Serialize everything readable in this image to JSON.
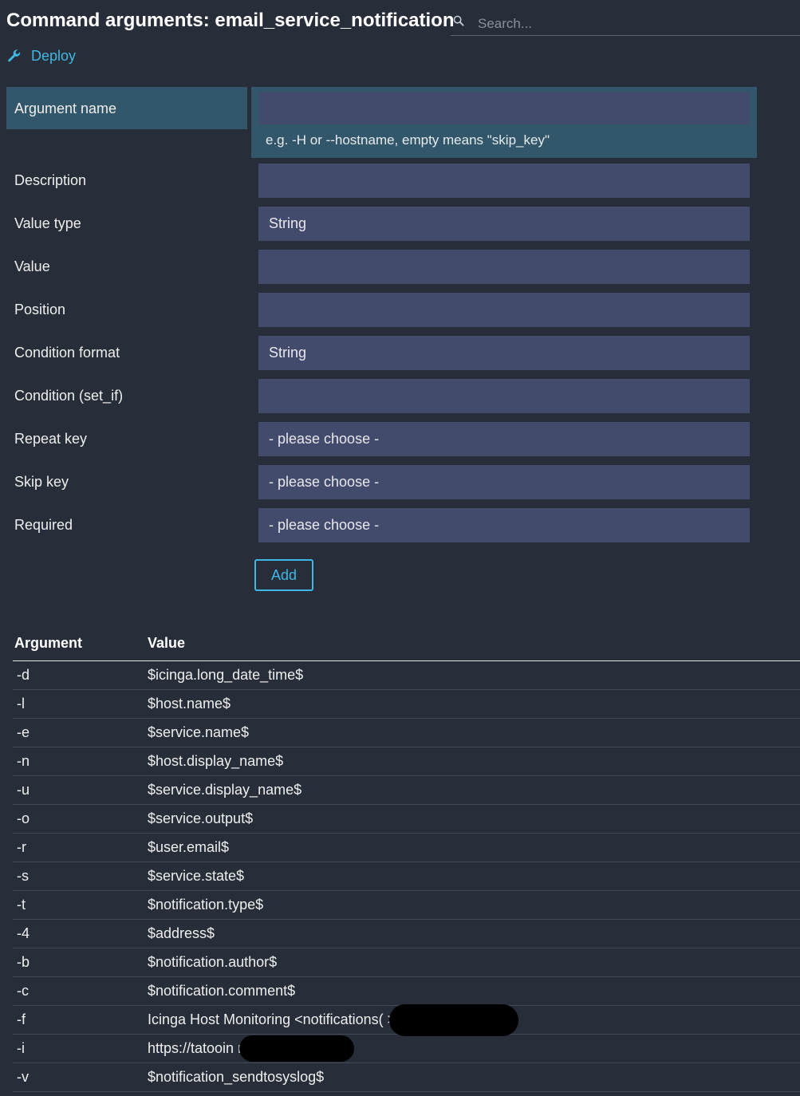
{
  "header": {
    "title": "Command arguments: email_service_notification",
    "search_placeholder": "Search..."
  },
  "actions": {
    "deploy_label": "Deploy"
  },
  "form": {
    "argument_name": {
      "label": "Argument name",
      "value": "",
      "hint": "e.g. -H or --hostname, empty means \"skip_key\""
    },
    "fields": [
      {
        "label": "Description",
        "value": ""
      },
      {
        "label": "Value type",
        "value": "String"
      },
      {
        "label": "Value",
        "value": ""
      },
      {
        "label": "Position",
        "value": ""
      },
      {
        "label": "Condition format",
        "value": "String"
      },
      {
        "label": "Condition (set_if)",
        "value": ""
      },
      {
        "label": "Repeat key",
        "value": "- please choose -"
      },
      {
        "label": "Skip key",
        "value": "- please choose -"
      },
      {
        "label": "Required",
        "value": "- please choose -"
      }
    ],
    "add_label": "Add"
  },
  "table": {
    "headers": {
      "argument": "Argument",
      "value": "Value"
    },
    "rows": [
      {
        "argument": "-d",
        "value": "$icinga.long_date_time$"
      },
      {
        "argument": "-l",
        "value": "$host.name$"
      },
      {
        "argument": "-e",
        "value": "$service.name$"
      },
      {
        "argument": "-n",
        "value": "$host.display_name$"
      },
      {
        "argument": "-u",
        "value": "$service.display_name$"
      },
      {
        "argument": "-o",
        "value": "$service.output$"
      },
      {
        "argument": "-r",
        "value": "$user.email$"
      },
      {
        "argument": "-s",
        "value": "$service.state$"
      },
      {
        "argument": "-t",
        "value": "$notification.type$"
      },
      {
        "argument": "-4",
        "value": "$address$"
      },
      {
        "argument": "-b",
        "value": "$notification.author$"
      },
      {
        "argument": "-c",
        "value": "$notification.comment$"
      },
      {
        "argument": "-f",
        "value": "Icinga Host Monitoring <notifications(                        >"
      },
      {
        "argument": "-i",
        "value": "https://tatooin                       rg/icingaweb2"
      },
      {
        "argument": "-v",
        "value": "$notification_sendtosyslog$"
      }
    ]
  },
  "colors": {
    "background": "#282e39",
    "accent": "#3fb7e4",
    "input": "#434b6c",
    "active_row": "#32576a"
  }
}
